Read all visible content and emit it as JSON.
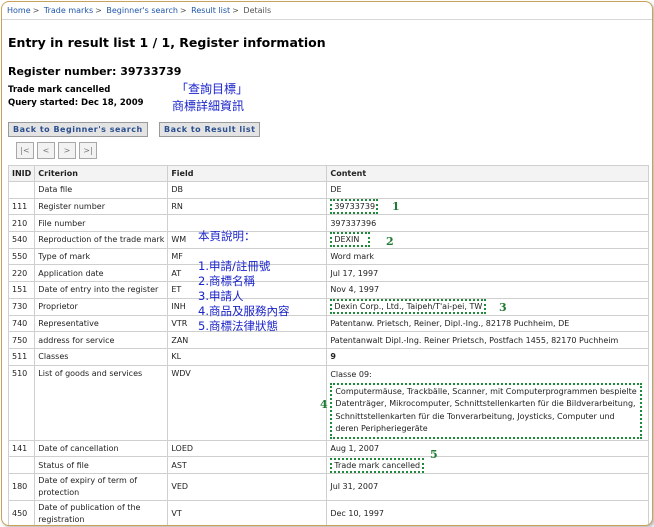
{
  "breadcrumb": [
    "Home",
    "Trade marks",
    "Beginner's search",
    "Result list",
    "Details"
  ],
  "page_title": "Entry in result list 1 / 1, Register information",
  "register_number_line": "Register number: 39733739",
  "status_text": "Trade mark cancelled",
  "query_started": "Query started: Dec 18, 2009",
  "annotation_query": [
    "「查詢目標」",
    "商標詳細資訊"
  ],
  "annotation_notes": {
    "title": "本頁說明：",
    "items": [
      "1.申請/註冊號",
      "2.商標名稱",
      "3.申請人",
      "4.商品及服務內容",
      "5.商標法律狀態"
    ]
  },
  "buttons": {
    "back_beginner": "Back to  Beginner's search",
    "back_result": "Back to  Result list"
  },
  "pager": [
    "|<",
    "<",
    ">",
    ">|"
  ],
  "table": {
    "headers": [
      "INID",
      "Criterion",
      "Field",
      "Content"
    ],
    "rows": [
      {
        "inid": "",
        "criterion": "Data file",
        "field": "DB",
        "content": "DE"
      },
      {
        "inid": "111",
        "criterion": "Register number",
        "field": "RN",
        "content": "39733739",
        "mark": "1"
      },
      {
        "inid": "210",
        "criterion": "File number",
        "field": "",
        "content": "397337396"
      },
      {
        "inid": "540",
        "criterion": "Reproduction of the trade mark",
        "field": "WM",
        "content": "DEXIN",
        "mark": "2"
      },
      {
        "inid": "550",
        "criterion": "Type of mark",
        "field": "MF",
        "content": "Word mark"
      },
      {
        "inid": "220",
        "criterion": "Application date",
        "field": "AT",
        "content": "Jul 17, 1997"
      },
      {
        "inid": "151",
        "criterion": "Date of entry into the register",
        "field": "ET",
        "content": "Nov 4, 1997"
      },
      {
        "inid": "730",
        "criterion": "Proprietor",
        "field": "INH",
        "content": "Dexin Corp., Ltd., Taipeh/T'ai-pei, TW",
        "mark": "3"
      },
      {
        "inid": "740",
        "criterion": "Representative",
        "field": "VTR",
        "content": "Patentanw. Prietsch, Reiner, Dipl.-Ing., 82178 Puchheim, DE"
      },
      {
        "inid": "750",
        "criterion": "address for service",
        "field": "ZAN",
        "content": "Patentanwalt Dipl.-Ing. Reiner Prietsch, Postfach 1455, 82170 Puchheim"
      },
      {
        "inid": "511",
        "criterion": "Classes",
        "field": "KL",
        "content": "9"
      },
      {
        "inid": "510",
        "criterion": "List of goods and services",
        "field": "WDV",
        "content_head": "Classe 09:",
        "content": "Computermäuse, Trackbälle, Scanner, mit Computerprogrammen bespielte Datenträger, Mikrocomputer, Schnittstellenkarten für die Bildverarbeitung, Schnittstellenkarten für die Tonverarbeitung, Joysticks, Computer und deren Peripheriegeräte",
        "mark": "4"
      },
      {
        "inid": "141",
        "criterion": "Date of cancellation",
        "field": "LOED",
        "content": "Aug 1, 2007"
      },
      {
        "inid": "",
        "criterion": "Status of file",
        "field": "AST",
        "content": "Trade mark cancelled",
        "mark": "5"
      },
      {
        "inid": "180",
        "criterion": "Date of expiry of term of protection",
        "field": "VED",
        "content": "Jul 31, 2007"
      },
      {
        "inid": "450",
        "criterion": "Date of publication of the registration",
        "field": "VT",
        "content": "Dec 10, 1997"
      }
    ]
  }
}
